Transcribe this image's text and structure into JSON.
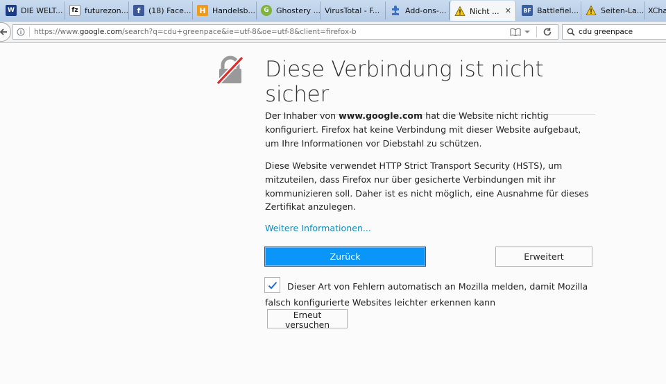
{
  "tabs": [
    {
      "label": "DIE WELT...",
      "icon": "welt-icon",
      "color": "#1b3c88",
      "glyph": "W"
    },
    {
      "label": "futurezon...",
      "icon": "futurezone-icon",
      "color": "#ffffff",
      "glyph": "fz"
    },
    {
      "label": "(18) Face...",
      "icon": "facebook-icon",
      "color": "#3b5998",
      "glyph": "f"
    },
    {
      "label": "Handelsb...",
      "icon": "handelsblatt-icon",
      "color": "#f29a16",
      "glyph": "H"
    },
    {
      "label": "Ghostery ...",
      "icon": "ghostery-icon",
      "color": "#7fb33a",
      "glyph": "G"
    },
    {
      "label": "VirusTotal - F...",
      "icon": "blank-page-icon",
      "color": "",
      "glyph": ""
    },
    {
      "label": "Add-ons-...",
      "icon": "puzzle-icon",
      "color": "#3a6fc4",
      "glyph": "✱"
    },
    {
      "label": "Nicht ...",
      "icon": "warning-icon",
      "color": "#f0c000",
      "glyph": "⚠",
      "active": true
    },
    {
      "label": "Battlefiel...",
      "icon": "battlefield-icon",
      "color": "#3a5fa0",
      "glyph": "BF"
    },
    {
      "label": "Seiten-La...",
      "icon": "warning-icon",
      "color": "#f0c000",
      "glyph": "⚠"
    },
    {
      "label": "XCha",
      "icon": "",
      "color": "",
      "glyph": ""
    }
  ],
  "nav": {
    "url_scheme": "https://www.",
    "url_domain": "google.com",
    "url_rest": "/search?q=cdu+greenpace&ie=utf-8&oe=utf-8&client=firefox-b",
    "search_value": "cdu greenpace"
  },
  "content": {
    "title": "Diese Verbindung ist nicht sicher",
    "para1_pre": "Der Inhaber von ",
    "para1_domain": "www.google.com",
    "para1_post": " hat die Website nicht richtig konfiguriert. Firefox hat keine Verbindung mit dieser Website aufgebaut, um Ihre Informationen vor Diebstahl zu schützen.",
    "para2": "Diese Website verwendet HTTP Strict Transport Security (HSTS), um mitzuteilen, dass Firefox nur über gesicherte Verbindungen mit ihr kommunizieren soll. Daher ist es nicht möglich, eine Ausnahme für dieses Zertifikat anzulegen.",
    "learn_more": "Weitere Informationen...",
    "back_button": "Zurück",
    "advanced_button": "Erweitert",
    "report_checked": true,
    "report_text": "Dieser Art von Fehlern automatisch an Mozilla melden, damit Mozilla falsch konfigurierte Websites leichter erkennen kann",
    "retry_button": "Erneut versuchen"
  },
  "colors": {
    "primary_button": "#0996f8",
    "link": "#0a8dc1",
    "lock_strike": "#d92d2d"
  }
}
